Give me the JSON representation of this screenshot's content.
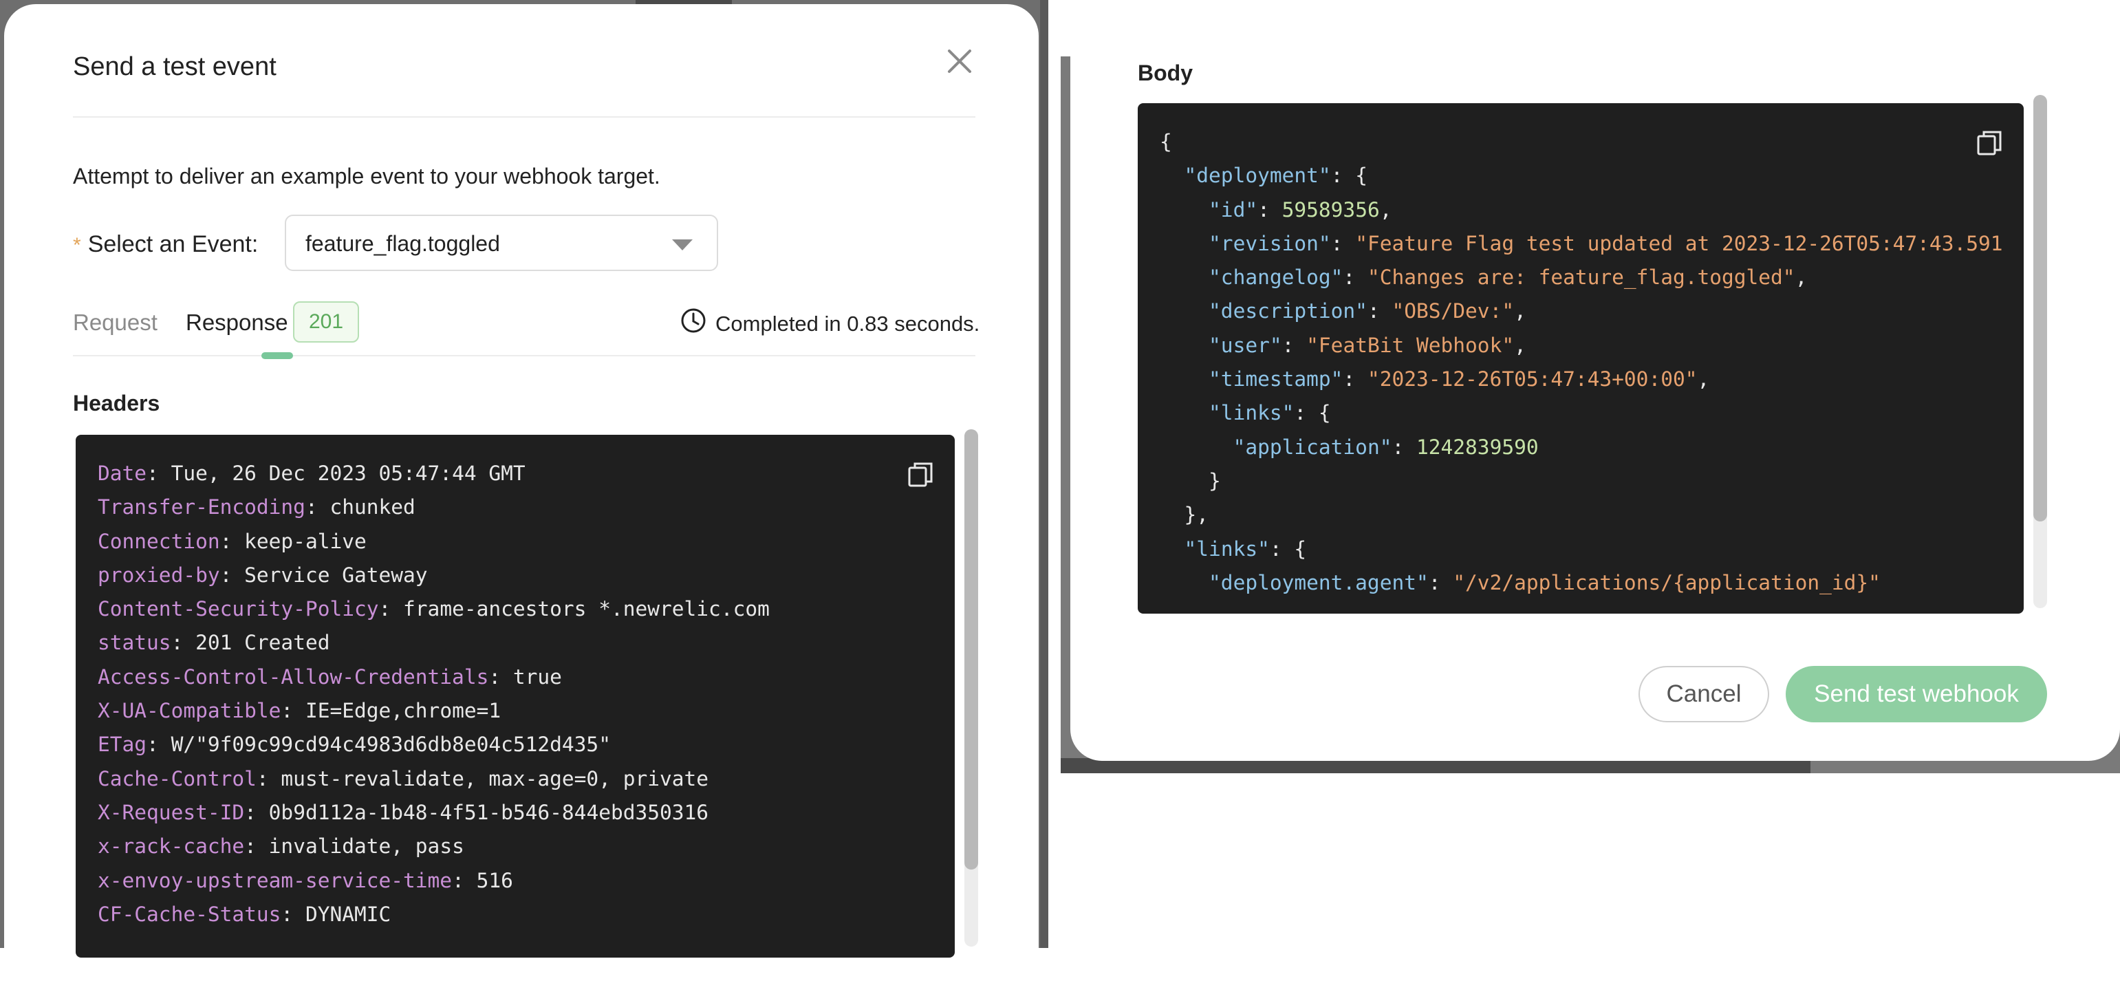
{
  "modal": {
    "title": "Send a test event",
    "description": "Attempt to deliver an example event to your webhook target.",
    "event_select": {
      "required_marker": "*",
      "label": "Select an Event",
      "label_colon": ":",
      "value": "feature_flag.toggled"
    },
    "tabs": [
      {
        "label": "Request",
        "active": false
      },
      {
        "label": "Response",
        "active": true
      }
    ],
    "status_code": "201",
    "completed_text": "Completed in 0.83 seconds."
  },
  "headers": {
    "title": "Headers",
    "lines": [
      {
        "key": "Date",
        "value": "Tue, 26 Dec 2023 05:47:44 GMT"
      },
      {
        "key": "Transfer-Encoding",
        "value": "chunked"
      },
      {
        "key": "Connection",
        "value": "keep-alive"
      },
      {
        "key": "proxied-by",
        "value": "Service Gateway"
      },
      {
        "key": "Content-Security-Policy",
        "value": "frame-ancestors *.newrelic.com"
      },
      {
        "key": "status",
        "value": "201 Created"
      },
      {
        "key": "Access-Control-Allow-Credentials",
        "value": "true"
      },
      {
        "key": "X-UA-Compatible",
        "value": "IE=Edge,chrome=1"
      },
      {
        "key": "ETag",
        "value": "W/\"9f09c99cd94c4983d6db8e04c512d435\""
      },
      {
        "key": "Cache-Control",
        "value": "must-revalidate, max-age=0, private"
      },
      {
        "key": "X-Request-ID",
        "value": "0b9d112a-1b48-4f51-b546-844ebd350316"
      },
      {
        "key": "x-rack-cache",
        "value": "invalidate, pass"
      },
      {
        "key": "x-envoy-upstream-service-time",
        "value": "516"
      },
      {
        "key": "CF-Cache-Status",
        "value": "DYNAMIC"
      }
    ]
  },
  "body": {
    "title": "Body",
    "lines": [
      [
        {
          "t": "p",
          "s": "{"
        }
      ],
      [
        {
          "t": "p",
          "s": "  "
        },
        {
          "t": "key",
          "s": "\"deployment\""
        },
        {
          "t": "p",
          "s": ": {"
        }
      ],
      [
        {
          "t": "p",
          "s": "    "
        },
        {
          "t": "key",
          "s": "\"id\""
        },
        {
          "t": "p",
          "s": ": "
        },
        {
          "t": "num",
          "s": "59589356"
        },
        {
          "t": "p",
          "s": ","
        }
      ],
      [
        {
          "t": "p",
          "s": "    "
        },
        {
          "t": "key",
          "s": "\"revision\""
        },
        {
          "t": "p",
          "s": ": "
        },
        {
          "t": "str",
          "s": "\"Feature Flag test updated at 2023-12-26T05:47:43.591"
        }
      ],
      [
        {
          "t": "p",
          "s": "    "
        },
        {
          "t": "key",
          "s": "\"changelog\""
        },
        {
          "t": "p",
          "s": ": "
        },
        {
          "t": "str",
          "s": "\"Changes are: feature_flag.toggled\""
        },
        {
          "t": "p",
          "s": ","
        }
      ],
      [
        {
          "t": "p",
          "s": "    "
        },
        {
          "t": "key",
          "s": "\"description\""
        },
        {
          "t": "p",
          "s": ": "
        },
        {
          "t": "str",
          "s": "\"OBS/Dev:\""
        },
        {
          "t": "p",
          "s": ","
        }
      ],
      [
        {
          "t": "p",
          "s": "    "
        },
        {
          "t": "key",
          "s": "\"user\""
        },
        {
          "t": "p",
          "s": ": "
        },
        {
          "t": "str",
          "s": "\"FeatBit Webhook\""
        },
        {
          "t": "p",
          "s": ","
        }
      ],
      [
        {
          "t": "p",
          "s": "    "
        },
        {
          "t": "key",
          "s": "\"timestamp\""
        },
        {
          "t": "p",
          "s": ": "
        },
        {
          "t": "str",
          "s": "\"2023-12-26T05:47:43+00:00\""
        },
        {
          "t": "p",
          "s": ","
        }
      ],
      [
        {
          "t": "p",
          "s": "    "
        },
        {
          "t": "key",
          "s": "\"links\""
        },
        {
          "t": "p",
          "s": ": {"
        }
      ],
      [
        {
          "t": "p",
          "s": "      "
        },
        {
          "t": "key",
          "s": "\"application\""
        },
        {
          "t": "p",
          "s": ": "
        },
        {
          "t": "num",
          "s": "1242839590"
        }
      ],
      [
        {
          "t": "p",
          "s": "    }"
        }
      ],
      [
        {
          "t": "p",
          "s": "  },"
        }
      ],
      [
        {
          "t": "p",
          "s": "  "
        },
        {
          "t": "key",
          "s": "\"links\""
        },
        {
          "t": "p",
          "s": ": {"
        }
      ],
      [
        {
          "t": "p",
          "s": "    "
        },
        {
          "t": "key",
          "s": "\"deployment.agent\""
        },
        {
          "t": "p",
          "s": ": "
        },
        {
          "t": "str",
          "s": "\"/v2/applications/{application_id}\""
        }
      ]
    ]
  },
  "footer": {
    "cancel_label": "Cancel",
    "send_label": "Send test webhook"
  },
  "icons": {
    "close": "close-icon",
    "dropdown": "chevron-down-icon",
    "clock": "clock-icon",
    "copy": "copy-icon"
  },
  "colors": {
    "accent_green": "#8fcfa2",
    "status_badge_text": "#5aa95a",
    "code_background": "#1f1f1f",
    "header_key": "#c98fd6",
    "json_key": "#8ec3e6",
    "json_string": "#e6a16e",
    "json_number": "#c7e3a8"
  }
}
